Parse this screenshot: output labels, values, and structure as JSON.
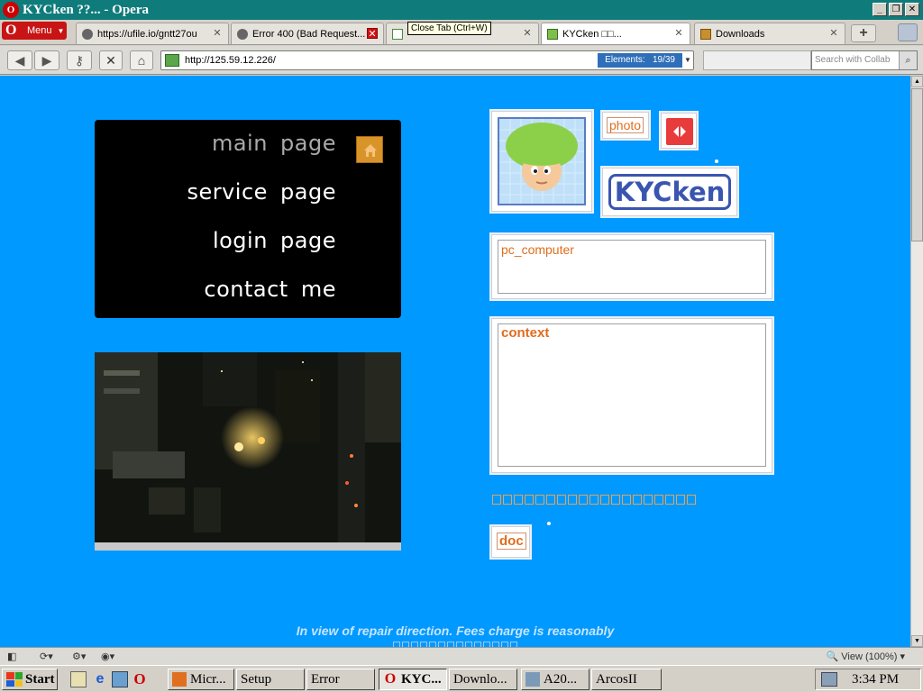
{
  "window": {
    "title": "KYCken ??... - Opera",
    "minimize_icon": "minimize-icon",
    "maximize_icon": "restore-icon",
    "close_icon": "close-icon"
  },
  "tabs": {
    "menu_label": "Menu",
    "items": [
      {
        "label": "https://ufile.io/gntt27ou",
        "close": "✕"
      },
      {
        "label": "Error 400 (Bad Request...",
        "close": "✕"
      },
      {
        "label": "",
        "close": "✕"
      },
      {
        "label": "KYCken □□...",
        "close": "✕"
      },
      {
        "label": "Downloads",
        "close": "✕"
      }
    ],
    "new_tab": "+",
    "tooltip": "Close Tab (Ctrl+W)"
  },
  "toolbar": {
    "url": "http://125.59.12.226/",
    "elements_label": "Elements:",
    "elements_count": "19/39",
    "search_placeholder": "Search with Collab"
  },
  "page": {
    "nav": {
      "main": "main page",
      "service": "service page",
      "login": "login page",
      "contact": "contact me"
    },
    "photo_label": "photo",
    "logo_text": "KYCken",
    "pc_field": "pc_computer",
    "context_field": "context",
    "doc_label": "doc",
    "footer": "In view of repair direction. Fees charge is reasonably",
    "colors": {
      "background": "#0099ff",
      "accent_text": "#e06d1e",
      "nav_box": "#000000"
    }
  },
  "statusbar": {
    "view": "View (100%)"
  },
  "taskbar": {
    "start": "Start",
    "buttons": [
      "Micr...",
      "Setup",
      "Error",
      "KYC...",
      "Downlo...",
      "A20...",
      "ArcosII"
    ],
    "clock": "3:34 PM"
  }
}
